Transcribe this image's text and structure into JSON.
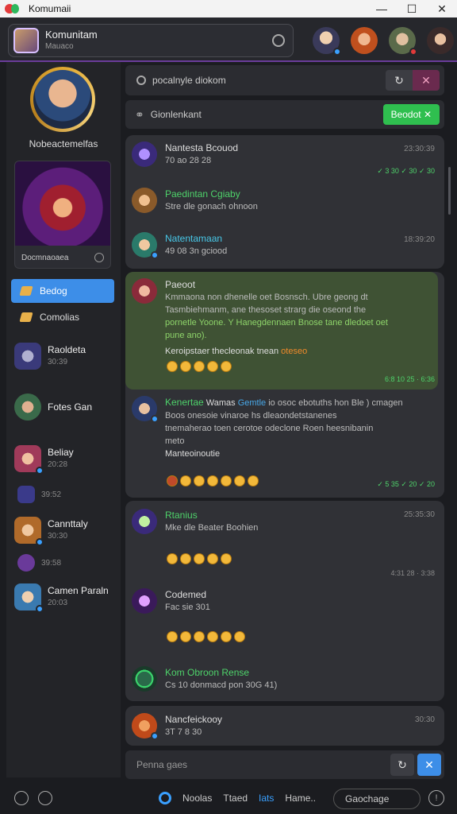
{
  "window": {
    "title": "Komumaii",
    "controls": [
      "—",
      "☐",
      "✕"
    ]
  },
  "header": {
    "name": "Komunitam",
    "sub": "Mauaco"
  },
  "sidebar": {
    "profile_name": "Nobeactemelfas",
    "hero_label": "Docmnaoaea",
    "nav": [
      {
        "label": "Bedog",
        "active": true
      },
      {
        "label": "Comolias",
        "active": false
      }
    ],
    "channels": [
      {
        "name": "Raoldeta",
        "sub": "30:39"
      },
      {
        "name": "Fotes Gan",
        "sub": ""
      },
      {
        "name": "Beliay",
        "sub": "20:28"
      },
      {
        "name": "Cannttaly",
        "sub": "30:30"
      },
      {
        "name": "Camen Paraln",
        "sub": "20:03"
      }
    ],
    "small": [
      "39:52",
      "39:58"
    ]
  },
  "search": {
    "text": "pocalnyle diokom"
  },
  "filter": {
    "label": "Gionlenkant",
    "button": "Beodot ✕"
  },
  "messages": {
    "card1": [
      {
        "name": "Nantesta Bcouod",
        "body": "70 ao 28 28",
        "time": "23:30:39"
      },
      {
        "name": "Paedintan Cgiaby",
        "body": "Stre dle gonach ohnoon",
        "time": ""
      },
      {
        "name": "Natentamaan",
        "body": "49 08 3n gciood",
        "time": "18:39:20"
      }
    ],
    "card1_green": "✓ 3 30 ✓ 30 ✓ 30",
    "card2": {
      "name": "Paeoot",
      "line1": "Kmmaona non dhenelle oet Bosnsch. Ubre geong dt",
      "line2": "Tasmbiehmanm, ane thesoset strarg die oseond the",
      "line3": "pornetle Yoone. Y Hanegdennaen Bnose tane dledoet oet",
      "line4": "pune ano).",
      "line5": "Keroipstaer thecleonak tnean",
      "orange": "oteseo",
      "green_time": "6:8 10 25 · 6:36",
      "reply_name": "Kenertae",
      "reply_tag": "Wamas",
      "reply_tag2": "Gemtle",
      "reply_rest": "io osoc ebotuths hon Ble ) cmagen",
      "reply_line2": "Boos onesoie vinaroe hs dleaondetstanenes",
      "reply_line3": "tnemaherao toen cerotoe odeclone Roen heesnibanin",
      "reply_line4": "meto",
      "reply_line5": "Manteoinoutie",
      "green_time2": "✓ 5 35 ✓ 20 ✓ 20"
    },
    "card3": [
      {
        "name": "Rtanius",
        "body": "Mke dle Beater Boohien",
        "time": "25:35:30"
      },
      {
        "name": "Codemed",
        "body": "Fac sie 301",
        "time": ""
      },
      {
        "name": "Kom Obroon Rense",
        "body": "Cs 10 donmacd pon 30G 41)",
        "time": ""
      }
    ],
    "card3_time": "4:31 28 · 3:38",
    "card4": {
      "name": "Nancfeickooy",
      "body": "3T 7 8 30",
      "time": "30:30"
    }
  },
  "composer": {
    "placeholder": "Penna gaes"
  },
  "footer": {
    "tabs": [
      "Noolas",
      "Ttaed",
      "Iats",
      "Hame.."
    ],
    "search": "Gaochage",
    "info": "!"
  },
  "colors": {
    "accent_blue": "#3d8ee8",
    "green": "#2fbf4f",
    "highlight": "#3f5234"
  }
}
